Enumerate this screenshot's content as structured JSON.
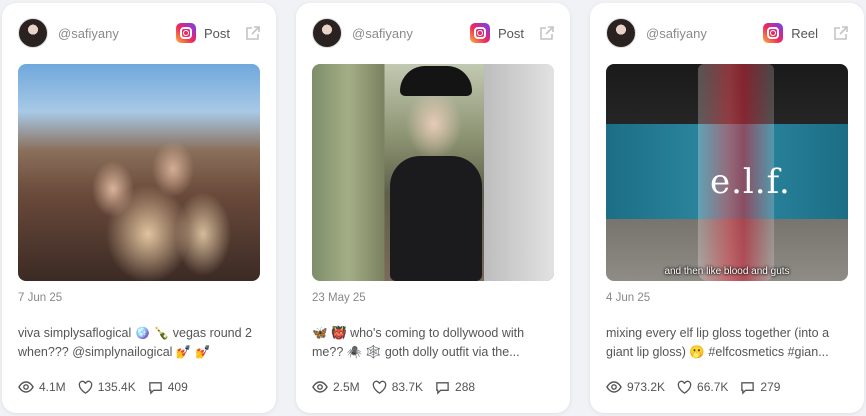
{
  "cards": [
    {
      "handle": "@safiyany",
      "post_type": "Post",
      "date": "7 Jun 25",
      "caption": "viva simplysaflogical 🪩 🍾 vegas round 2 when??? @simplynailogical 💅 💅",
      "views": "4.1M",
      "likes": "135.4K",
      "comments": "409",
      "overlay_text": ""
    },
    {
      "handle": "@safiyany",
      "post_type": "Post",
      "date": "23 May 25",
      "caption": "🦋 👹 who's coming to dollywood with me?? 🕷️ 🕸️ goth dolly outfit via the...",
      "views": "2.5M",
      "likes": "83.7K",
      "comments": "288",
      "overlay_text": ""
    },
    {
      "handle": "@safiyany",
      "post_type": "Reel",
      "date": "4 Jun 25",
      "caption": "mixing every elf lip gloss together (into a giant lip gloss) 🫢 #elfcosmetics #gian...",
      "views": "973.2K",
      "likes": "66.7K",
      "comments": "279",
      "overlay_text": "and then like blood and guts",
      "brand_text": "e.l.f."
    }
  ],
  "icons": {
    "platform": "instagram-icon",
    "external": "external-link-icon",
    "views": "eye-icon",
    "likes": "heart-icon",
    "comments": "comment-icon"
  },
  "colors": {
    "background": "#f1f2f5",
    "card": "#ffffff",
    "text": "#555555",
    "muted": "#888888"
  }
}
